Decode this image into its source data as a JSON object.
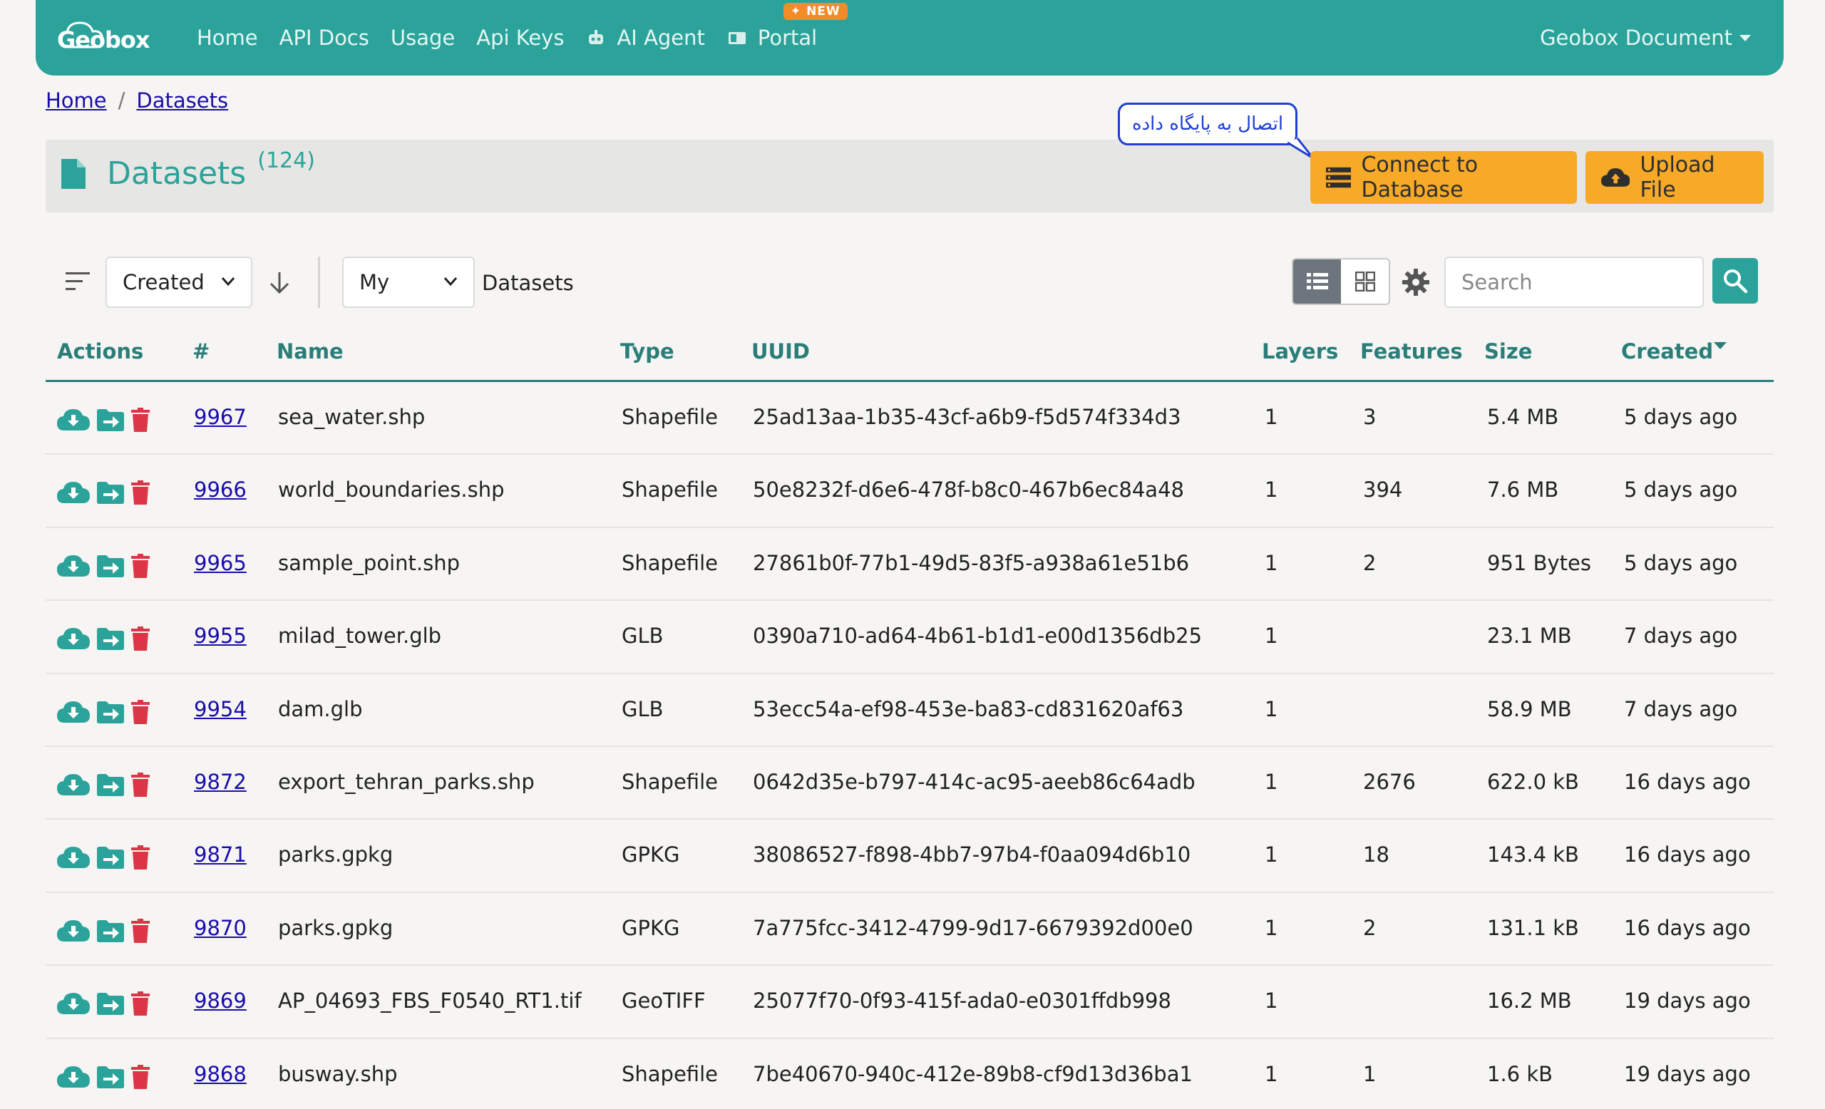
{
  "nav": {
    "logo": "Geobox",
    "links": [
      "Home",
      "API Docs",
      "Usage",
      "Api Keys",
      "AI Agent",
      "Portal"
    ],
    "new_badge": "NEW",
    "right_menu": "Geobox Document"
  },
  "breadcrumb": {
    "home": "Home",
    "current": "Datasets"
  },
  "header": {
    "title": "Datasets",
    "count": "(124)",
    "connect_label": "Connect to Database",
    "upload_label": "Upload File",
    "bubble_text": "اتصال به پایگاه داده"
  },
  "toolbar": {
    "sort_field": "Created",
    "owner_filter": "My",
    "suffix": "Datasets",
    "search_placeholder": "Search"
  },
  "table": {
    "columns": [
      "Actions",
      "#",
      "Name",
      "Type",
      "UUID",
      "Layers",
      "Features",
      "Size",
      "Created"
    ],
    "rows": [
      {
        "id": "9967",
        "name": "sea_water.shp",
        "type": "Shapefile",
        "uuid": "25ad13aa-1b35-43cf-a6b9-f5d574f334d3",
        "layers": "1",
        "features": "3",
        "size": "5.4 MB",
        "created": "5 days ago"
      },
      {
        "id": "9966",
        "name": "world_boundaries.shp",
        "type": "Shapefile",
        "uuid": "50e8232f-d6e6-478f-b8c0-467b6ec84a48",
        "layers": "1",
        "features": "394",
        "size": "7.6 MB",
        "created": "5 days ago"
      },
      {
        "id": "9965",
        "name": "sample_point.shp",
        "type": "Shapefile",
        "uuid": "27861b0f-77b1-49d5-83f5-a938a61e51b6",
        "layers": "1",
        "features": "2",
        "size": "951 Bytes",
        "created": "5 days ago"
      },
      {
        "id": "9955",
        "name": "milad_tower.glb",
        "type": "GLB",
        "uuid": "0390a710-ad64-4b61-b1d1-e00d1356db25",
        "layers": "1",
        "features": "",
        "size": "23.1 MB",
        "created": "7 days ago"
      },
      {
        "id": "9954",
        "name": "dam.glb",
        "type": "GLB",
        "uuid": "53ecc54a-ef98-453e-ba83-cd831620af63",
        "layers": "1",
        "features": "",
        "size": "58.9 MB",
        "created": "7 days ago"
      },
      {
        "id": "9872",
        "name": "export_tehran_parks.shp",
        "type": "Shapefile",
        "uuid": "0642d35e-b797-414c-ac95-aeeb86c64adb",
        "layers": "1",
        "features": "2676",
        "size": "622.0 kB",
        "created": "16 days ago"
      },
      {
        "id": "9871",
        "name": "parks.gpkg",
        "type": "GPKG",
        "uuid": "38086527-f898-4bb7-97b4-f0aa094d6b10",
        "layers": "1",
        "features": "18",
        "size": "143.4 kB",
        "created": "16 days ago"
      },
      {
        "id": "9870",
        "name": "parks.gpkg",
        "type": "GPKG",
        "uuid": "7a775fcc-3412-4799-9d17-6679392d00e0",
        "layers": "1",
        "features": "2",
        "size": "131.1 kB",
        "created": "16 days ago"
      },
      {
        "id": "9869",
        "name": "AP_04693_FBS_F0540_RT1.tif",
        "type": "GeoTIFF",
        "uuid": "25077f70-0f93-415f-ada0-e0301ffdb998",
        "layers": "1",
        "features": "",
        "size": "16.2 MB",
        "created": "19 days ago"
      },
      {
        "id": "9868",
        "name": "busway.shp",
        "type": "Shapefile",
        "uuid": "7be40670-940c-412e-89b8-cf9d13d36ba1",
        "layers": "1",
        "features": "1",
        "size": "1.6 kB",
        "created": "19 days ago"
      }
    ]
  },
  "colors": {
    "brand": "#2ba39a",
    "accent_orange": "#f7a928",
    "new_badge": "#f28c28",
    "delete_red": "#dc3545",
    "link": "#1a0dab"
  }
}
